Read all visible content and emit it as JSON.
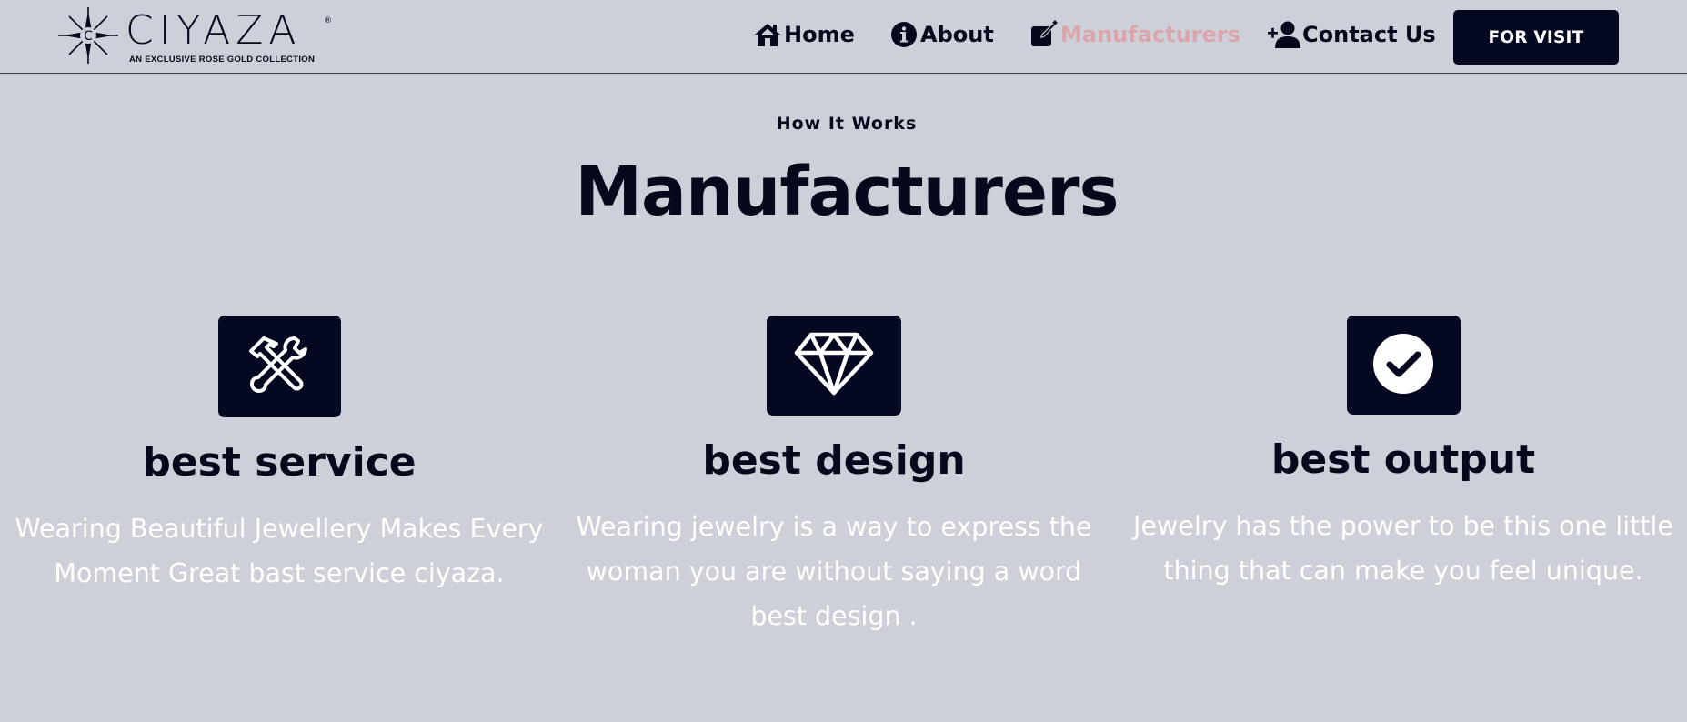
{
  "brand": {
    "name": "CIYAZA",
    "registered": "®",
    "tagline": "AN EXCLUSIVE ROSE GOLD COLLECTION",
    "logo_icon": "sparkle-star-icon"
  },
  "nav": {
    "items": [
      {
        "label": "Home",
        "icon": "home-icon",
        "active": false
      },
      {
        "label": "About",
        "icon": "info-icon",
        "active": false
      },
      {
        "label": "Manufacturers",
        "icon": "edit-icon",
        "active": true
      },
      {
        "label": "Contact Us",
        "icon": "add-user-icon",
        "active": false
      }
    ],
    "cta_label": "FOR VISIT"
  },
  "section": {
    "eyebrow": "How It Works",
    "title": "Manufacturers"
  },
  "features": [
    {
      "icon": "tools-icon",
      "title": "best service",
      "description": "Wearing Beautiful Jewellery Makes Every Moment Great bast service ciyaza."
    },
    {
      "icon": "diamond-icon",
      "title": "best design",
      "description": "Wearing jewelry is a way to express the woman you are without saying a word best design ."
    },
    {
      "icon": "check-circle-icon",
      "title": "best output",
      "description": "Jewelry has the power to be this one little thing that can make you feel unique."
    }
  ],
  "colors": {
    "background": "#cdd0d8",
    "dark": "#050821",
    "active_link": "#dba6ab",
    "description_text": "#ffffff"
  }
}
